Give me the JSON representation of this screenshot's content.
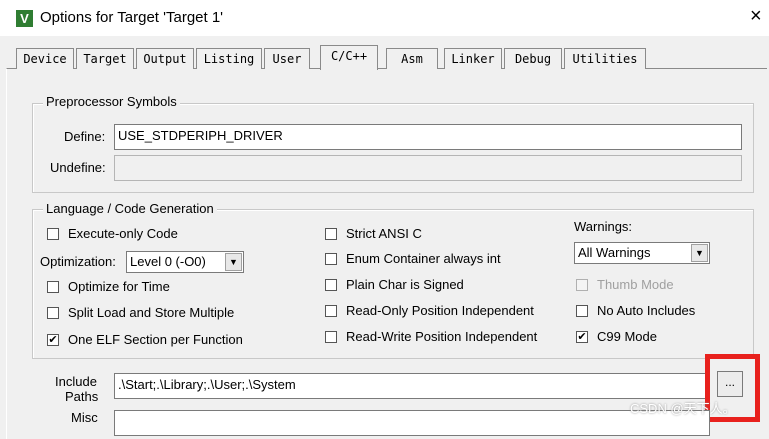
{
  "window": {
    "title": "Options for Target 'Target 1'",
    "close_glyph": "×",
    "icon_letter": "V"
  },
  "tabs": [
    {
      "label": "Device"
    },
    {
      "label": "Target"
    },
    {
      "label": "Output"
    },
    {
      "label": "Listing"
    },
    {
      "label": "User"
    },
    {
      "label": "C/C++"
    },
    {
      "label": "Asm"
    },
    {
      "label": "Linker"
    },
    {
      "label": "Debug"
    },
    {
      "label": "Utilities"
    }
  ],
  "active_tab": "C/C++",
  "preprocessor": {
    "legend": "Preprocessor Symbols",
    "define_label": "Define:",
    "define_value": "USE_STDPERIPH_DRIVER",
    "undefine_label": "Undefine:",
    "undefine_value": ""
  },
  "codegen": {
    "legend": "Language / Code Generation",
    "execute_only": {
      "label": "Execute-only Code",
      "checked": false
    },
    "optimization_label": "Optimization:",
    "optimization_value": "Level 0 (-O0)",
    "optimize_time": {
      "label": "Optimize for Time",
      "checked": false
    },
    "split_load": {
      "label": "Split Load and Store Multiple",
      "checked": false
    },
    "one_elf": {
      "label": "One ELF Section per Function",
      "checked": true,
      "mark": "✔"
    },
    "strict_ansi": {
      "label": "Strict ANSI C",
      "checked": false
    },
    "enum_int": {
      "label": "Enum Container always int",
      "checked": false
    },
    "plain_char": {
      "label": "Plain Char is Signed",
      "checked": false
    },
    "ro_pi": {
      "label": "Read-Only Position Independent",
      "checked": false
    },
    "rw_pi": {
      "label": "Read-Write Position Independent",
      "checked": false
    },
    "warnings_label": "Warnings:",
    "warnings_value": "All Warnings",
    "thumb_mode": {
      "label": "Thumb Mode",
      "checked": false,
      "disabled": true
    },
    "no_auto_includes": {
      "label": "No Auto Includes",
      "checked": false
    },
    "c99_mode": {
      "label": "C99 Mode",
      "checked": true,
      "mark": "✔"
    }
  },
  "include": {
    "label_line1": "Include",
    "label_line2": "Paths",
    "value": ".\\Start;.\\Library;.\\User;.\\System",
    "browse_label": "..."
  },
  "misc": {
    "label": "Misc"
  },
  "watermark": "CSDN @天下人。",
  "colors": {
    "highlight": "#e8211d",
    "icon_bg": "#2f7d32"
  }
}
